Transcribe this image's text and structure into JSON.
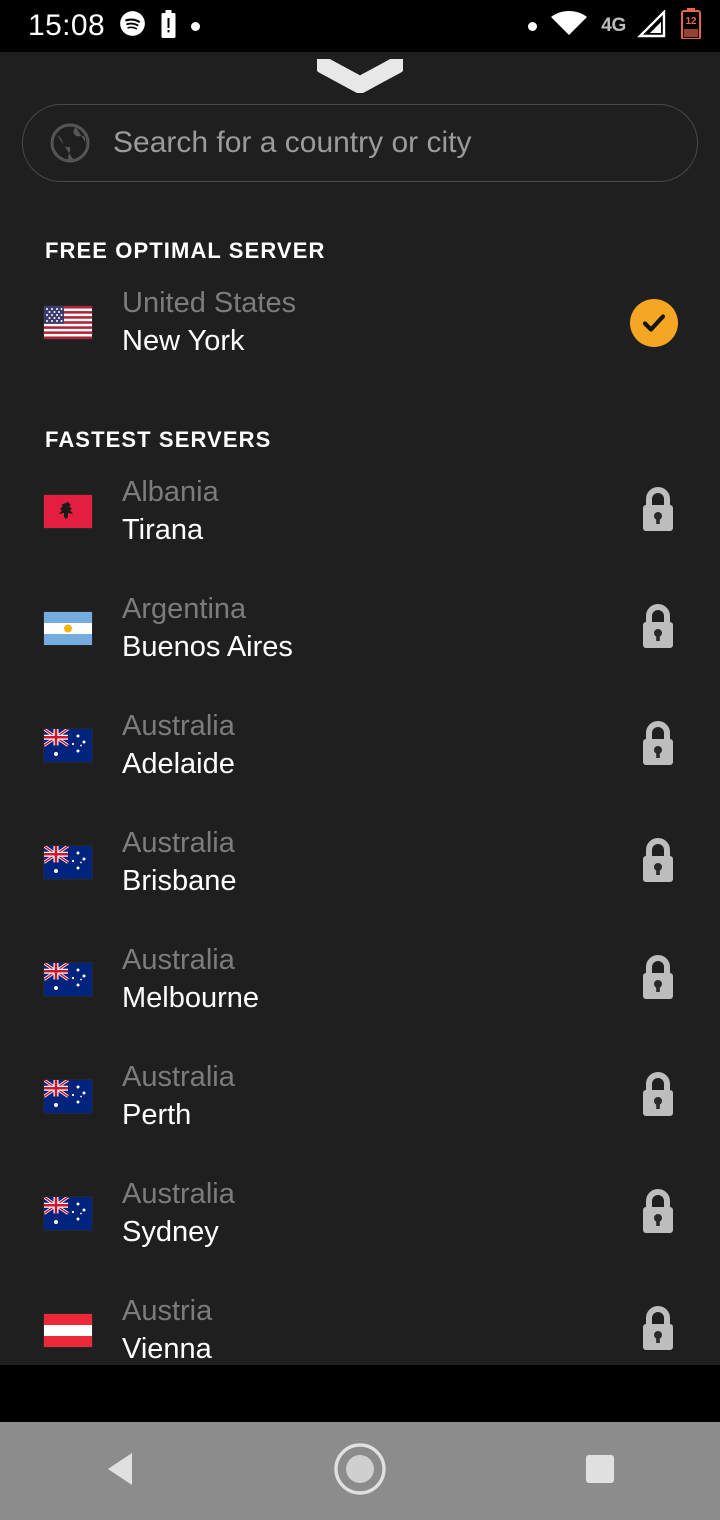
{
  "statusbar": {
    "time": "15:08",
    "left_icons": [
      "spotify-icon",
      "battery-alert-icon",
      "dot-icon"
    ],
    "right_icons": [
      "dot-icon",
      "wifi-icon",
      "signal-icon",
      "battery-icon"
    ],
    "network_label": "4G",
    "battery_level_label": "12"
  },
  "sheet": {
    "handle_icon": "chevron-down-icon"
  },
  "search": {
    "icon": "globe-icon",
    "placeholder": "Search for a country or city",
    "value": ""
  },
  "sections": [
    {
      "title": "FREE OPTIMAL SERVER",
      "rows": [
        {
          "country": "United States",
          "city": "New York",
          "flag": "us",
          "status": "selected",
          "status_icon": "check-circle-icon"
        }
      ]
    },
    {
      "title": "FASTEST SERVERS",
      "rows": [
        {
          "country": "Albania",
          "city": "Tirana",
          "flag": "al",
          "status": "locked",
          "status_icon": "lock-icon"
        },
        {
          "country": "Argentina",
          "city": "Buenos Aires",
          "flag": "ar",
          "status": "locked",
          "status_icon": "lock-icon"
        },
        {
          "country": "Australia",
          "city": "Adelaide",
          "flag": "au",
          "status": "locked",
          "status_icon": "lock-icon"
        },
        {
          "country": "Australia",
          "city": "Brisbane",
          "flag": "au",
          "status": "locked",
          "status_icon": "lock-icon"
        },
        {
          "country": "Australia",
          "city": "Melbourne",
          "flag": "au",
          "status": "locked",
          "status_icon": "lock-icon"
        },
        {
          "country": "Australia",
          "city": "Perth",
          "flag": "au",
          "status": "locked",
          "status_icon": "lock-icon"
        },
        {
          "country": "Australia",
          "city": "Sydney",
          "flag": "au",
          "status": "locked",
          "status_icon": "lock-icon"
        },
        {
          "country": "Austria",
          "city": "Vienna",
          "flag": "at",
          "status": "locked",
          "status_icon": "lock-icon"
        }
      ]
    }
  ],
  "navbar": {
    "back_label": "Back",
    "home_label": "Home",
    "recents_label": "Recents"
  },
  "colors": {
    "accent_orange": "#f5a623",
    "sheet_background": "#1f1f1f",
    "statusbar_background": "#000000",
    "navbar_background": "#8c8c8c",
    "country_text": "#7c7c7c",
    "city_text": "#ffffff",
    "lock_icon": "#bdbdbd"
  }
}
